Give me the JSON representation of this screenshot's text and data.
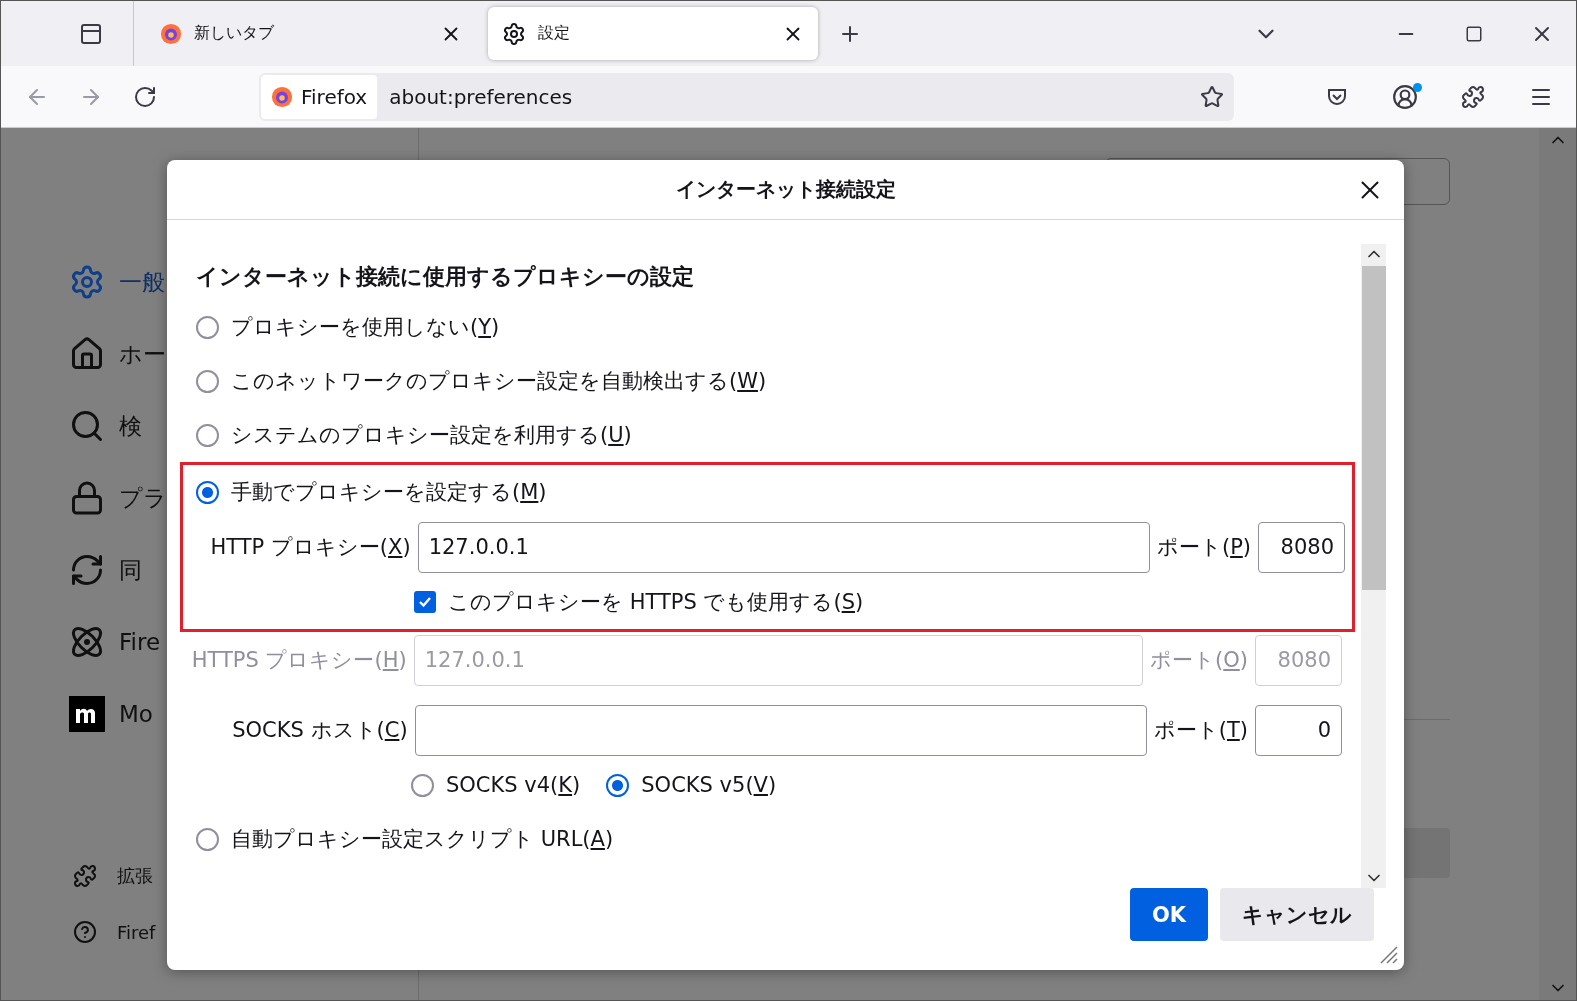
{
  "tabs": [
    {
      "title": "新しいタブ",
      "kind": "firefox",
      "selected": false
    },
    {
      "title": "設定",
      "kind": "gear",
      "selected": true
    }
  ],
  "urlbar": {
    "identity": "Firefox",
    "url": "about:preferences"
  },
  "sidebar": {
    "items": [
      {
        "label": "一般",
        "kind": "gear",
        "selected": true
      },
      {
        "label": "ホー",
        "kind": "home",
        "selected": false
      },
      {
        "label": "検",
        "kind": "search",
        "selected": false
      },
      {
        "label": "プラ",
        "kind": "lock",
        "selected": false
      },
      {
        "label": "同",
        "kind": "sync",
        "selected": false
      },
      {
        "label": "Fire",
        "kind": "atom",
        "selected": false
      },
      {
        "label": "Mo",
        "kind": "mozilla",
        "selected": false
      }
    ],
    "footer": [
      {
        "label": "拡張",
        "kind": "puzzle"
      },
      {
        "label": "Firef",
        "kind": "help"
      }
    ]
  },
  "dialog": {
    "title": "インターネット接続設定",
    "heading": "インターネット接続に使用するプロキシーの設定",
    "proxy_modes": [
      {
        "label": "プロキシーを使用しない",
        "accesskey": "(Y)",
        "selected": false
      },
      {
        "label": "このネットワークのプロキシー設定を自動検出する",
        "accesskey": "(W)",
        "selected": false
      },
      {
        "label": "システムのプロキシー設定を利用する",
        "accesskey": "(U)",
        "selected": false
      },
      {
        "label": "手動でプロキシーを設定する",
        "accesskey": "(M)",
        "selected": true
      }
    ],
    "http": {
      "label": "HTTP プロキシー",
      "accesskey": "(X)",
      "value": "127.0.0.1",
      "port_label": "ポート",
      "port_accesskey": "(P)",
      "port": "8080",
      "disabled": false
    },
    "use_for_https": {
      "label": "このプロキシーを HTTPS でも使用する",
      "accesskey": "(S)",
      "checked": true
    },
    "https": {
      "label": "HTTPS プロキシー",
      "accesskey": "(H)",
      "value": "127.0.0.1",
      "port_label": "ポート",
      "port_accesskey": "(O)",
      "port": "8080",
      "disabled": true
    },
    "socks": {
      "label": "SOCKS ホスト",
      "accesskey": "(C)",
      "port_label": "ポート",
      "port_accesskey": "(T)",
      "port": "0",
      "disabled": false
    },
    "socks_versions": [
      {
        "label": "SOCKS v4",
        "accesskey": "(K)",
        "selected": false
      },
      {
        "label": "SOCKS v5",
        "accesskey": "(V)",
        "selected": true
      }
    ],
    "auto_proxy": {
      "label": "自動プロキシー設定スクリプト URL",
      "accesskey": "(A)",
      "selected": false
    },
    "buttons": [
      {
        "label": "OK",
        "kind": "primary"
      },
      {
        "label": "キャンセル",
        "kind": "secondary"
      }
    ]
  }
}
